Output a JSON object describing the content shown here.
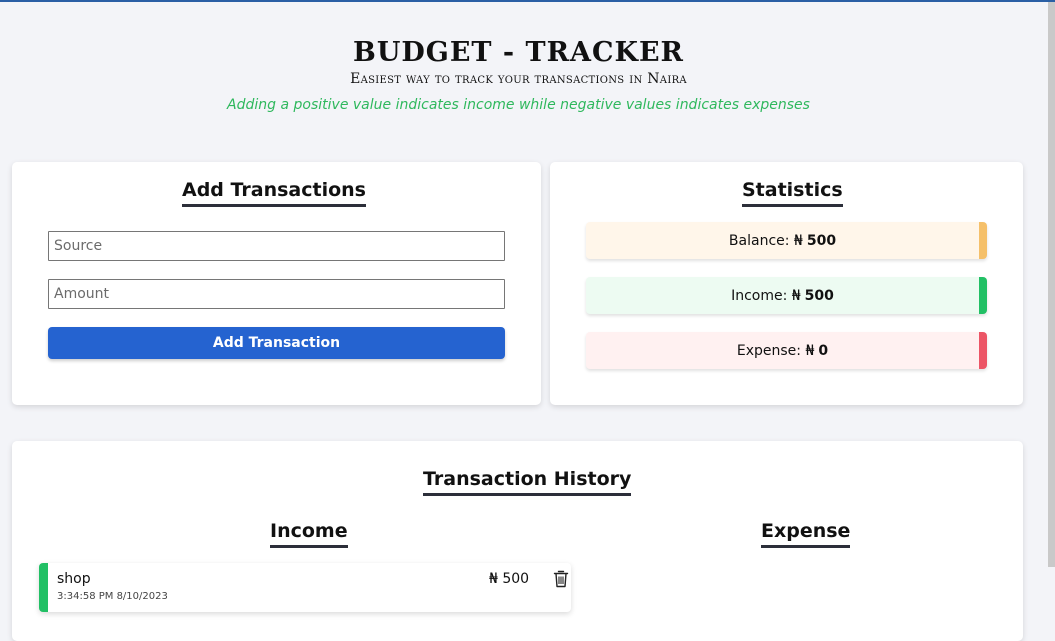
{
  "header": {
    "title": "BUDGET - TRACKER",
    "subtitle": "Easiest way to track your transactions in Naira",
    "hint": "Adding a positive value indicates income while negative values indicates expenses"
  },
  "add_form": {
    "heading": "Add Transactions",
    "source_placeholder": "Source",
    "source_value": "",
    "amount_placeholder": "Amount",
    "amount_value": "",
    "button_label": "Add Transaction"
  },
  "statistics": {
    "heading": "Statistics",
    "items": [
      {
        "label": "Balance: ₦",
        "value": "500",
        "color": "#f5c06a"
      },
      {
        "label": "Income: ₦",
        "value": "500",
        "color": "#22c065"
      },
      {
        "label": "Expense: ₦",
        "value": "0",
        "color": "#ec5566"
      }
    ]
  },
  "history": {
    "heading": "Transaction History",
    "income_heading": "Income",
    "expense_heading": "Expense",
    "income": [
      {
        "name": "shop",
        "time": "3:34:58 PM 8/10/2023",
        "amount": "₦ 500",
        "icon": "trash-icon"
      }
    ],
    "expense": []
  },
  "colors": {
    "accent": "#2563d0",
    "hint_text": "#2fb85d",
    "income": "#22c065",
    "expense": "#ec5566",
    "balance": "#f5c06a"
  }
}
